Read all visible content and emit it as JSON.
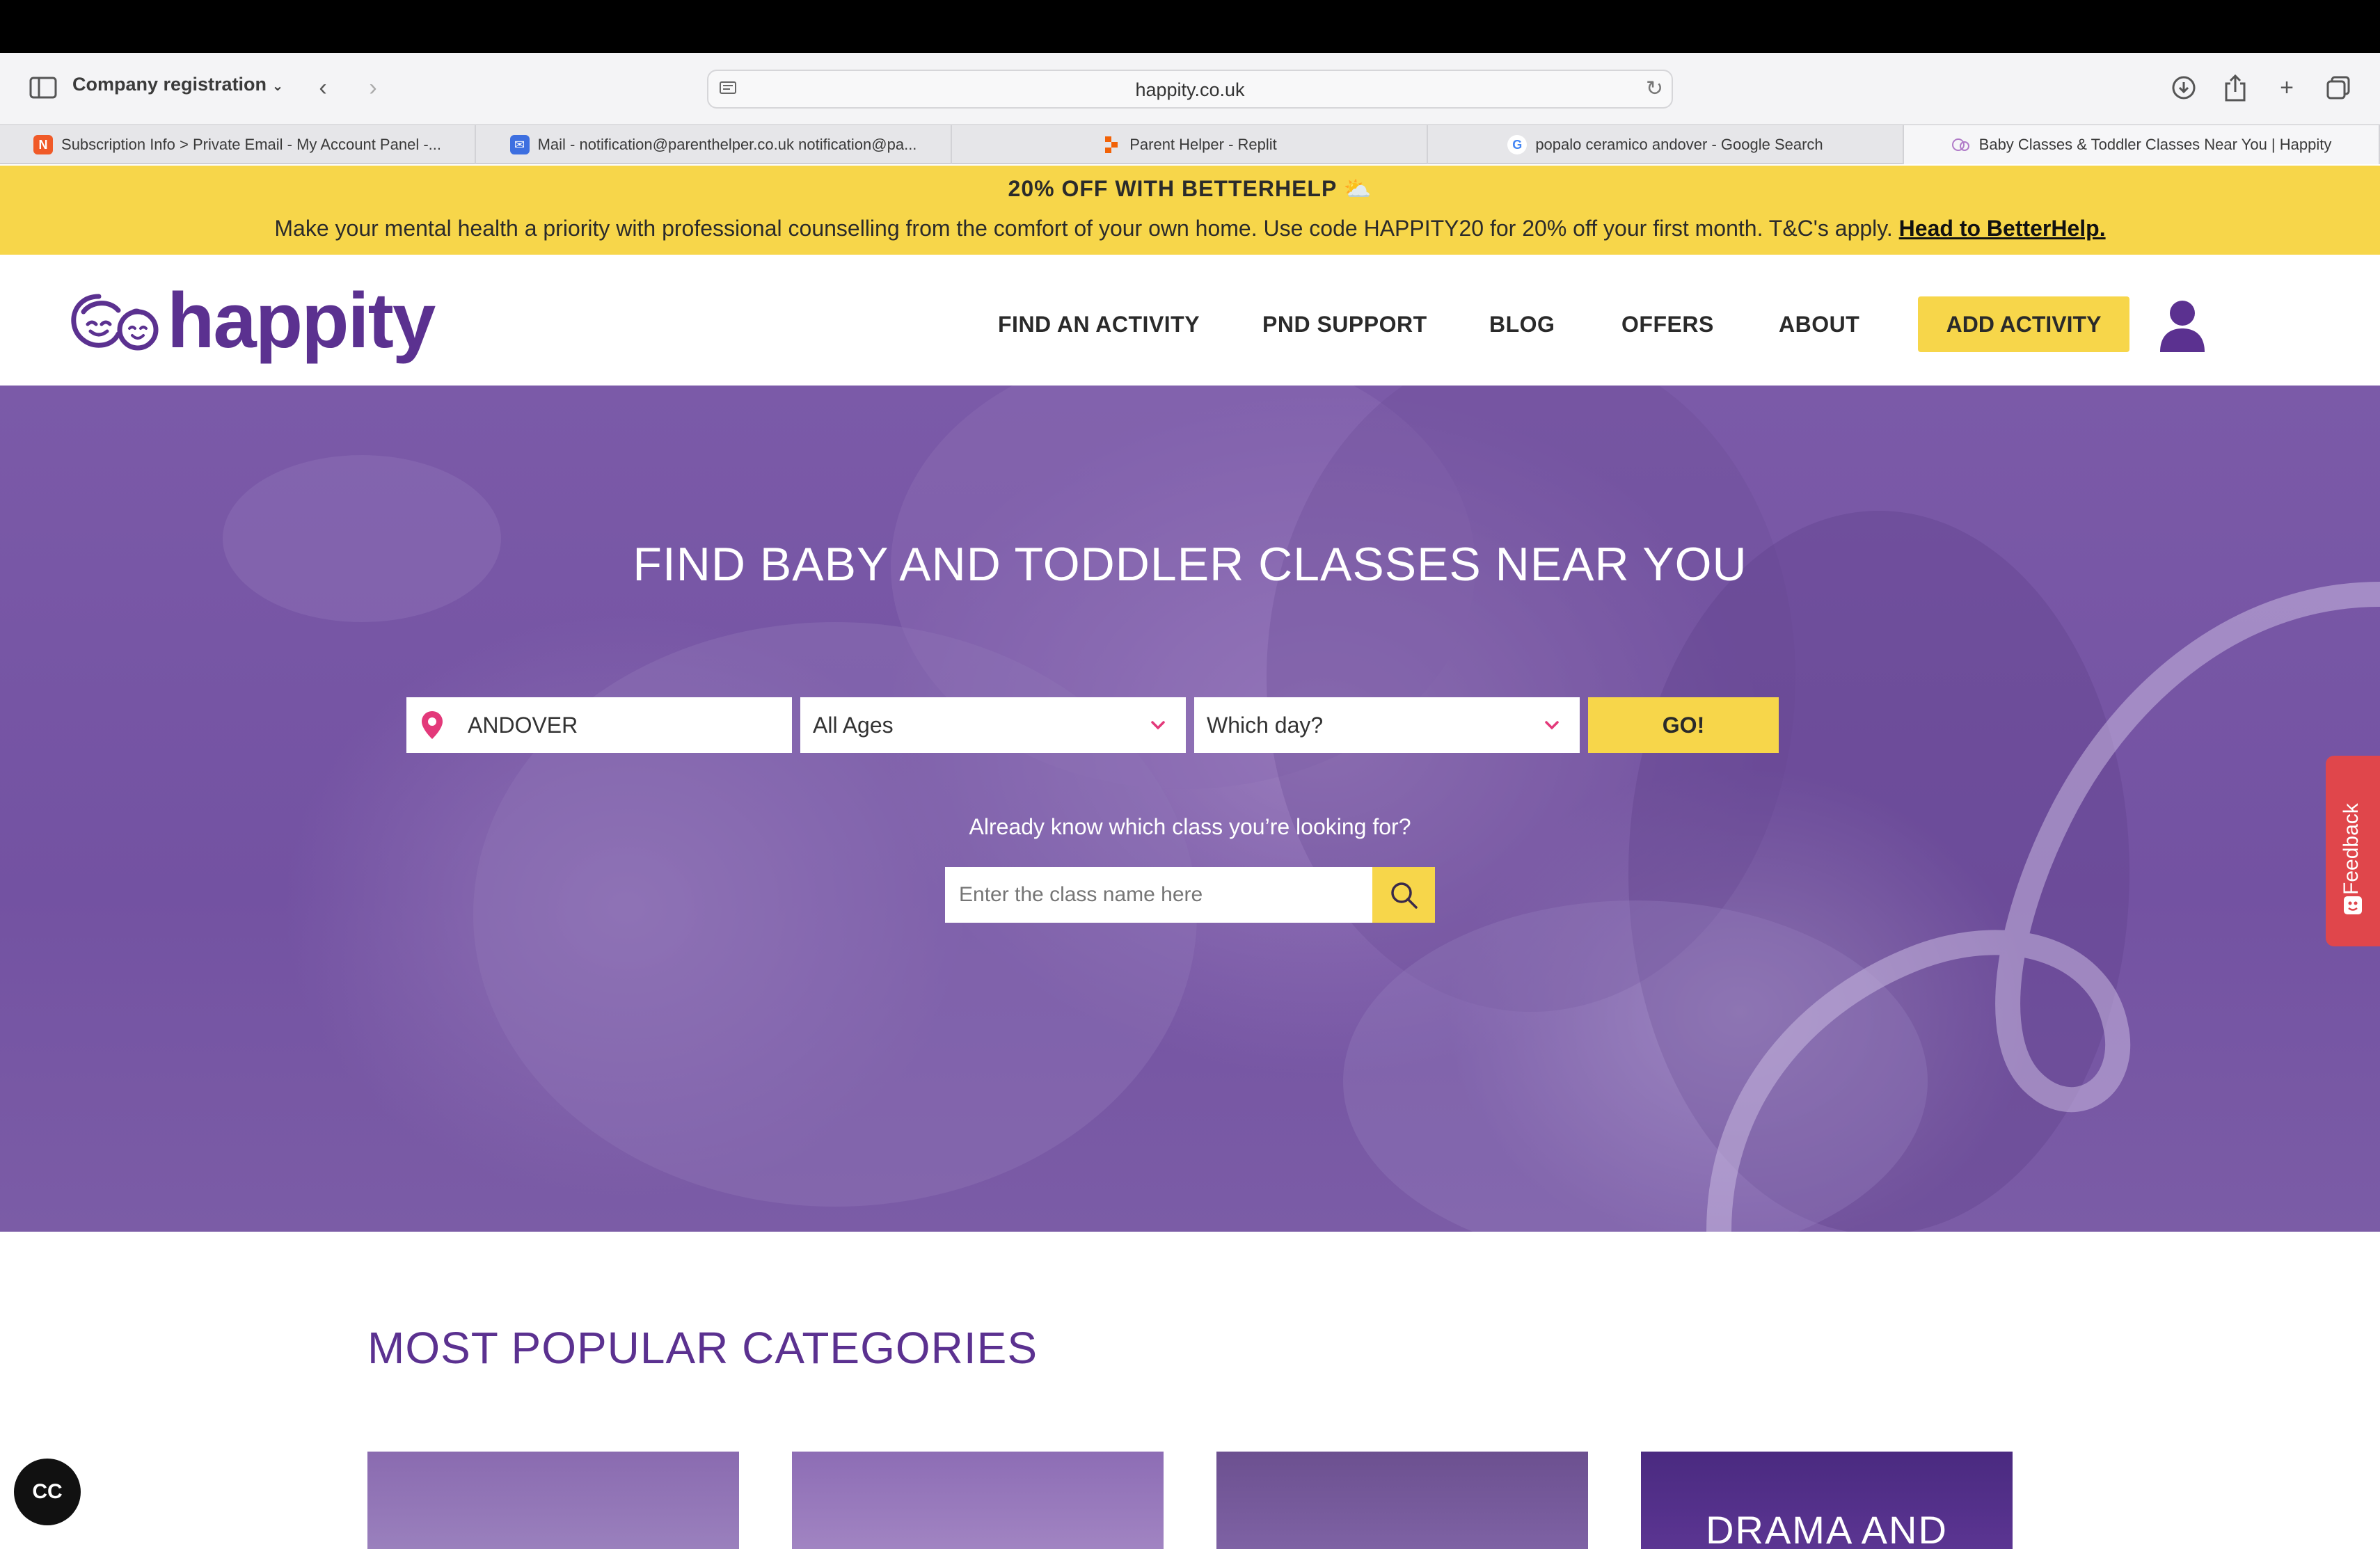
{
  "browser": {
    "tab_group": "Company registration",
    "url": "happity.co.uk",
    "tabs": [
      {
        "label": "Subscription Info > Private Email - My Account Panel -...",
        "favicon": "N"
      },
      {
        "label": "Mail - notification@parenthelper.co.uk notification@pa...",
        "favicon": "mail-icon"
      },
      {
        "label": "Parent Helper - Replit",
        "favicon": "replit-icon"
      },
      {
        "label": "popalo ceramico andover - Google Search",
        "favicon": "G"
      },
      {
        "label": "Baby Classes & Toddler Classes Near You | Happity",
        "favicon": "happity-icon"
      }
    ]
  },
  "promo": {
    "title": "20% OFF WITH BETTERHELP ⛅",
    "text": "Make your mental health a priority with professional counselling from the comfort of your own home. Use code HAPPITY20 for 20% off your first month. T&C's apply.",
    "link": "Head to BetterHelp."
  },
  "nav": {
    "logo": "happity",
    "links": [
      "FIND AN ACTIVITY",
      "PND SUPPORT",
      "BLOG",
      "OFFERS",
      "ABOUT"
    ],
    "cta": "ADD ACTIVITY"
  },
  "hero": {
    "title": "FIND BABY AND TODDLER CLASSES NEAR YOU",
    "location_value": "ANDOVER",
    "age_value": "All Ages",
    "day_placeholder": "Which day?",
    "go_label": "GO!",
    "already_text": "Already know which class you’re looking for?",
    "class_placeholder": "Enter the class name here"
  },
  "feedback_label": "Feedback",
  "popular": {
    "title": "MOST POPULAR CATEGORIES",
    "cards": [
      "",
      "",
      "",
      "DRAMA AND"
    ]
  },
  "cc_label": "CC",
  "colors": {
    "brand_purple": "#5b3190",
    "accent_yellow": "#f7d64a",
    "feedback_red": "#e0464b",
    "pin_pink": "#e3397a"
  }
}
